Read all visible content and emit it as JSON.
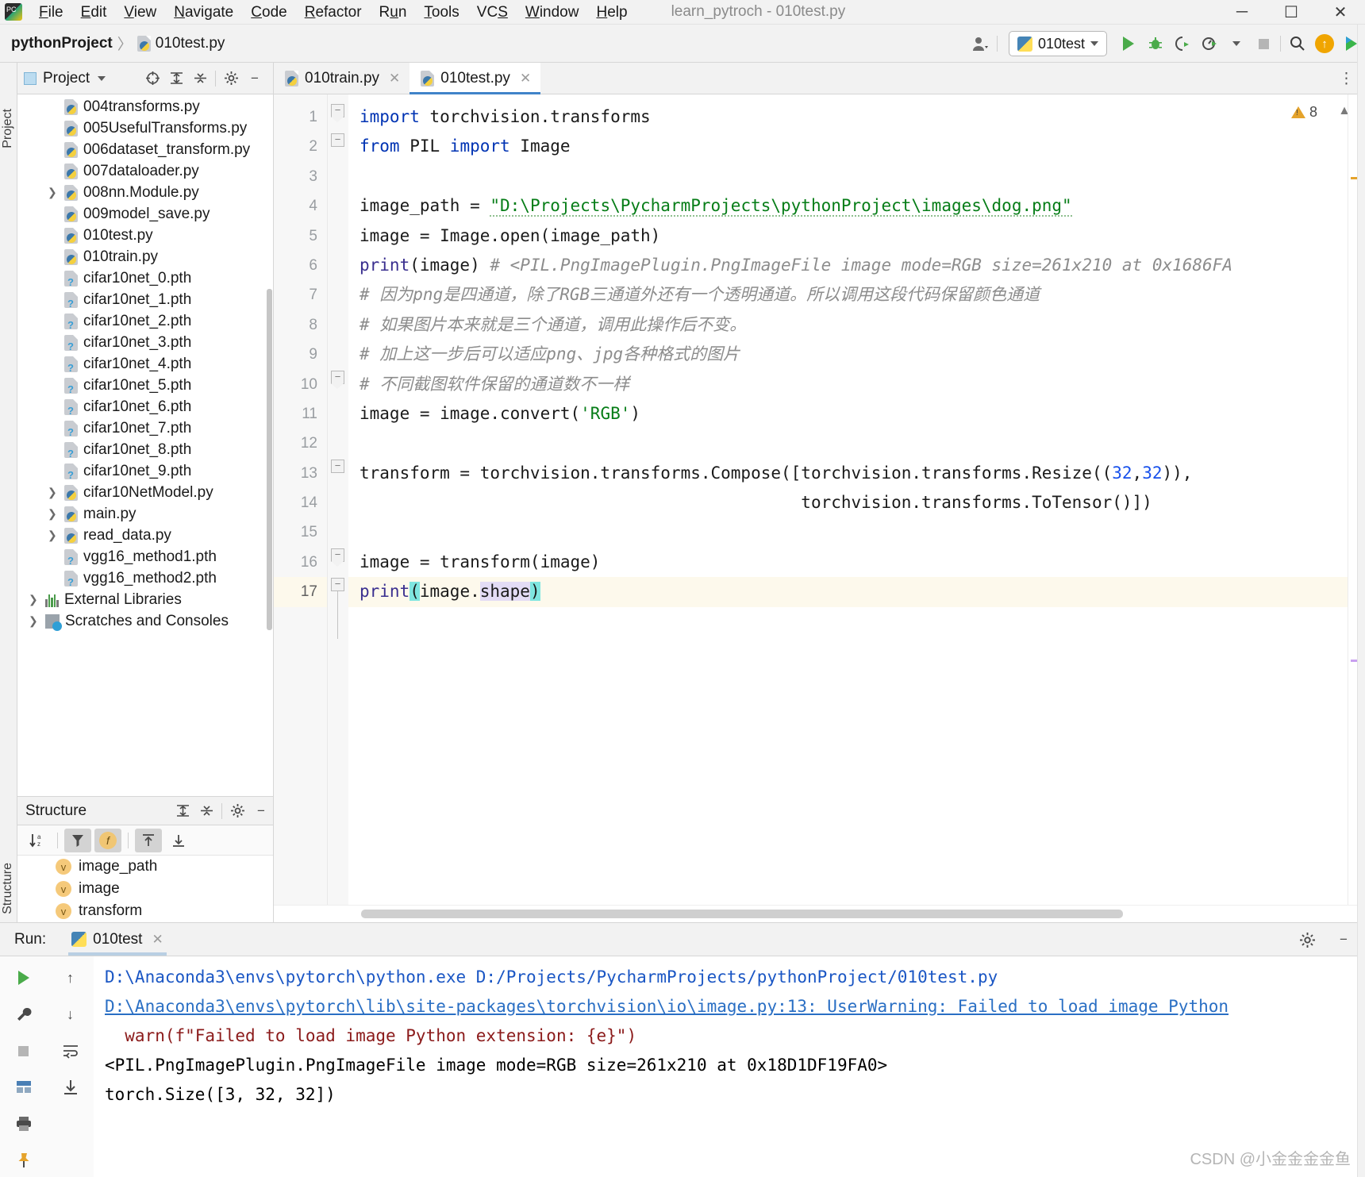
{
  "titlebar": {
    "menus": [
      "File",
      "Edit",
      "View",
      "Navigate",
      "Code",
      "Refactor",
      "Run",
      "Tools",
      "VCS",
      "Window",
      "Help"
    ],
    "window_title": "learn_pytroch - 010test.py",
    "minimize": "─",
    "maximize": "☐",
    "close": "✕"
  },
  "navbar": {
    "breadcrumb_project": "pythonProject",
    "breadcrumb_separator": "〉",
    "breadcrumb_file": "010test.py",
    "run_config": "010test",
    "run_config_caret": "▼"
  },
  "sidebar": {
    "title": "Project",
    "title_caret": "▼",
    "tree": [
      {
        "label": "004transforms.py",
        "icon": "python-file-icon",
        "chevron": false,
        "depth": 1
      },
      {
        "label": "005UsefulTransforms.py",
        "icon": "python-file-icon",
        "chevron": false,
        "depth": 1
      },
      {
        "label": "006dataset_transform.py",
        "icon": "python-file-icon",
        "chevron": false,
        "depth": 1
      },
      {
        "label": "007dataloader.py",
        "icon": "python-file-icon",
        "chevron": false,
        "depth": 1
      },
      {
        "label": "008nn.Module.py",
        "icon": "python-file-icon",
        "chevron": true,
        "depth": 1
      },
      {
        "label": "009model_save.py",
        "icon": "python-file-icon",
        "chevron": false,
        "depth": 1
      },
      {
        "label": "010test.py",
        "icon": "python-file-icon",
        "chevron": false,
        "depth": 1
      },
      {
        "label": "010train.py",
        "icon": "python-file-icon",
        "chevron": false,
        "depth": 1
      },
      {
        "label": "cifar10net_0.pth",
        "icon": "pth-file-icon",
        "chevron": false,
        "depth": 1
      },
      {
        "label": "cifar10net_1.pth",
        "icon": "pth-file-icon",
        "chevron": false,
        "depth": 1
      },
      {
        "label": "cifar10net_2.pth",
        "icon": "pth-file-icon",
        "chevron": false,
        "depth": 1
      },
      {
        "label": "cifar10net_3.pth",
        "icon": "pth-file-icon",
        "chevron": false,
        "depth": 1
      },
      {
        "label": "cifar10net_4.pth",
        "icon": "pth-file-icon",
        "chevron": false,
        "depth": 1
      },
      {
        "label": "cifar10net_5.pth",
        "icon": "pth-file-icon",
        "chevron": false,
        "depth": 1
      },
      {
        "label": "cifar10net_6.pth",
        "icon": "pth-file-icon",
        "chevron": false,
        "depth": 1
      },
      {
        "label": "cifar10net_7.pth",
        "icon": "pth-file-icon",
        "chevron": false,
        "depth": 1
      },
      {
        "label": "cifar10net_8.pth",
        "icon": "pth-file-icon",
        "chevron": false,
        "depth": 1
      },
      {
        "label": "cifar10net_9.pth",
        "icon": "pth-file-icon",
        "chevron": false,
        "depth": 1
      },
      {
        "label": "cifar10NetModel.py",
        "icon": "python-file-icon",
        "chevron": true,
        "depth": 1
      },
      {
        "label": "main.py",
        "icon": "python-file-icon",
        "chevron": true,
        "depth": 1
      },
      {
        "label": "read_data.py",
        "icon": "python-file-icon",
        "chevron": true,
        "depth": 1
      },
      {
        "label": "vgg16_method1.pth",
        "icon": "pth-file-icon",
        "chevron": false,
        "depth": 1
      },
      {
        "label": "vgg16_method2.pth",
        "icon": "pth-file-icon",
        "chevron": false,
        "depth": 1
      },
      {
        "label": "External Libraries",
        "icon": "libraries-icon",
        "chevron": true,
        "depth": 0
      },
      {
        "label": "Scratches and Consoles",
        "icon": "scratches-icon",
        "chevron": true,
        "depth": 0
      }
    ]
  },
  "structure": {
    "title": "Structure",
    "sort_icon": "sort-alpha-icon",
    "filter_icon": "filter-icon",
    "fields_icon": "fields-icon",
    "expand_icon": "expand-all-icon",
    "collapse_icon": "collapse-all-icon",
    "items": [
      {
        "kind": "v",
        "label": "image_path"
      },
      {
        "kind": "v",
        "label": "image"
      },
      {
        "kind": "v",
        "label": "transform"
      }
    ]
  },
  "left_strip": {
    "project_tab": "Project",
    "structure_tab": "Structure"
  },
  "editor": {
    "tabs": [
      {
        "label": "010train.py",
        "active": false
      },
      {
        "label": "010test.py",
        "active": true
      }
    ],
    "inspection_count": "8",
    "current_line": 17,
    "lines": [
      {
        "n": 1,
        "text": "import torchvision.transforms"
      },
      {
        "n": 2,
        "text": "from PIL import Image"
      },
      {
        "n": 3,
        "text": ""
      },
      {
        "n": 4,
        "text": "image_path = \"D:\\Projects\\PycharmProjects\\pythonProject\\images\\dog.png\""
      },
      {
        "n": 5,
        "text": "image = Image.open(image_path)"
      },
      {
        "n": 6,
        "text": "print(image) # <PIL.PngImagePlugin.PngImageFile image mode=RGB size=261x210 at 0x1686FA"
      },
      {
        "n": 7,
        "text": "# 因为png是四通道，除了RGB三通道外还有一个透明通道。所以调用这段代码保留颜色通道"
      },
      {
        "n": 8,
        "text": "# 如果图片本来就是三个通道，调用此操作后不变。"
      },
      {
        "n": 9,
        "text": "# 加上这一步后可以适应png、jpg各种格式的图片"
      },
      {
        "n": 10,
        "text": "# 不同截图软件保留的通道数不一样"
      },
      {
        "n": 11,
        "text": "image = image.convert('RGB')"
      },
      {
        "n": 12,
        "text": ""
      },
      {
        "n": 13,
        "text": "transform = torchvision.transforms.Compose([torchvision.transforms.Resize((32,32)),"
      },
      {
        "n": 14,
        "text": "                                            torchvision.transforms.ToTensor()])"
      },
      {
        "n": 15,
        "text": ""
      },
      {
        "n": 16,
        "text": "image = transform(image)"
      },
      {
        "n": 17,
        "text": "print(image.shape)"
      }
    ]
  },
  "run_panel": {
    "label": "Run:",
    "tab": "010test",
    "console_lines": [
      "D:\\Anaconda3\\envs\\pytorch\\python.exe D:/Projects/PycharmProjects/pythonProject/010test.py",
      "D:\\Anaconda3\\envs\\pytorch\\lib\\site-packages\\torchvision\\io\\image.py:13: UserWarning: Failed to load image Python",
      "  warn(f\"Failed to load image Python extension: {e}\")",
      "<PIL.PngImagePlugin.PngImageFile image mode=RGB size=261x210 at 0x18D1DF19FA0>",
      "torch.Size([3, 32, 32])"
    ]
  },
  "watermark": "CSDN @小金金金金鱼",
  "colors": {
    "accent_blue": "#4083c9",
    "keyword": "#0033b3",
    "string": "#067d17",
    "number": "#1750eb",
    "comment": "#8c8c8c",
    "warning": "#e5a32b",
    "run_green": "#4aab4a",
    "current_line": "#fdf9ec"
  }
}
